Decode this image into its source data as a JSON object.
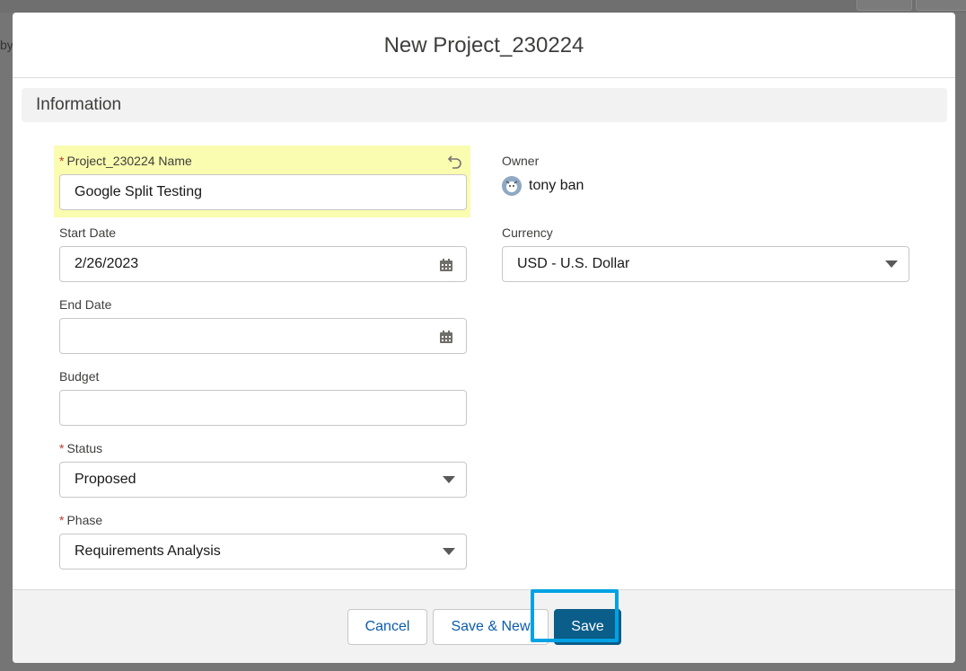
{
  "background": {
    "partial_text": "by"
  },
  "modal": {
    "title": "New Project_230224"
  },
  "section": {
    "title": "Information"
  },
  "fields": {
    "name": {
      "label": "Project_230224 Name",
      "required_mark": "*",
      "value": "Google Split Testing"
    },
    "start_date": {
      "label": "Start Date",
      "value": "2/26/2023"
    },
    "end_date": {
      "label": "End Date",
      "value": ""
    },
    "budget": {
      "label": "Budget",
      "value": ""
    },
    "status": {
      "label": "Status",
      "required_mark": "*",
      "value": "Proposed"
    },
    "phase": {
      "label": "Phase",
      "required_mark": "*",
      "value": "Requirements Analysis"
    },
    "owner": {
      "label": "Owner",
      "value": "tony ban"
    },
    "currency": {
      "label": "Currency",
      "value": "USD - U.S. Dollar"
    }
  },
  "footer": {
    "cancel_label": "Cancel",
    "save_new_label": "Save & New",
    "save_label": "Save"
  },
  "colors": {
    "brand": "#0b5d8a",
    "focus_outline": "#00a2e3",
    "highlight": "#fafcb0",
    "required": "#c23934"
  },
  "icons": [
    "undo-icon",
    "calendar-icon",
    "chevron-down-icon",
    "user-avatar-icon"
  ]
}
